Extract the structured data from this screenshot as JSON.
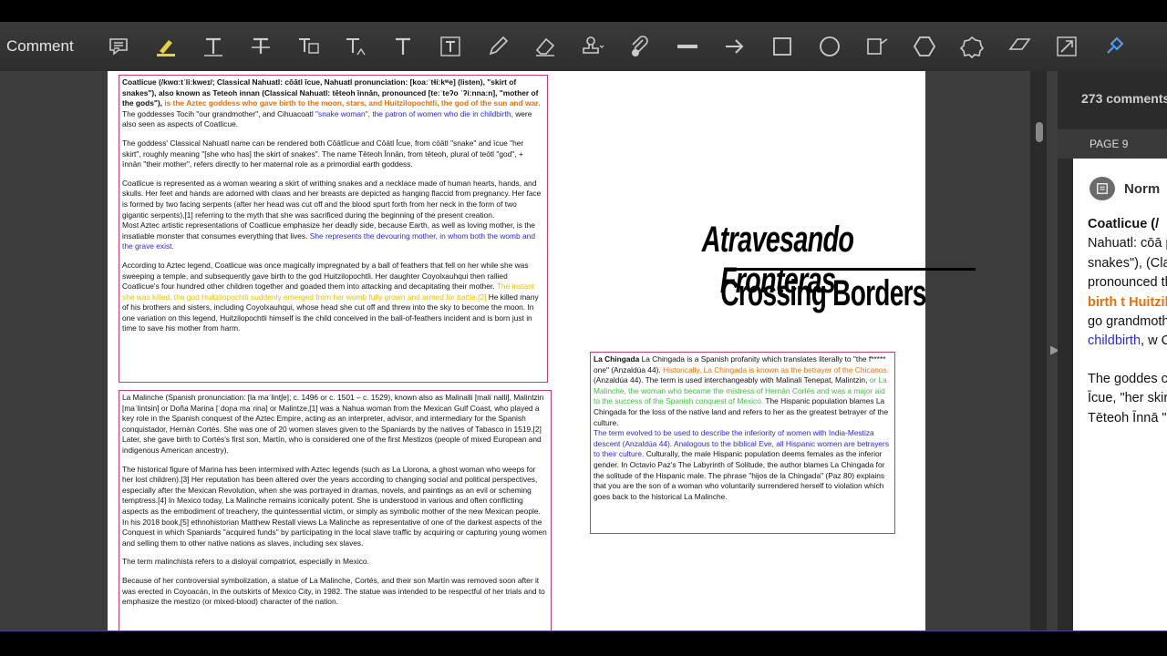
{
  "toolbar": {
    "label": "Comment",
    "tools": [
      "sticky-note-icon",
      "highlight-icon",
      "text-correction-icon",
      "strikethrough-icon",
      "replace-text-icon",
      "insert-text-icon",
      "add-text-icon",
      "text-box-icon",
      "pencil-icon",
      "eraser-icon",
      "stamp-icon",
      "attach-file-icon",
      "line-icon",
      "arrow-icon",
      "rectangle-icon",
      "oval-icon",
      "callout-icon",
      "polygon-icon",
      "cloud-icon",
      "polyline-icon",
      "connected-lines-icon",
      "pin-icon"
    ]
  },
  "document": {
    "coatlicue": {
      "p1_a": "Coatlicue (/kwɑːtˈliːkweɪ/; Classical Nahuatl: cōātl īcue, Nahuatl pronunciation: [koaːˈtɬíːkʷe] (listen), \"skirt of snakes\"), also known as Teteoh innan (Classical Nahuatl: tēteoh īnnān, pronounced [teːˈteʔo ˈʔiːnnaːn], \"mother of the gods\"), ",
      "p1_orange": "is the Aztec goddess who gave birth to the moon, stars, and Huitzilopochtli, the god of the sun and war",
      "p1_b": ". The goddesses Tocih \"our grandmother\", and Cihuacoatl ",
      "p1_blue": "\"snake woman\", the patron of women who die in childbirth",
      "p1_c": ", were also seen as aspects of Coatlicue.",
      "p2": "The goddess' Classical Nahuatl name can be rendered both Cōātlīcue and Cōātl Īcue, from cōātl \"snake\" and īcue \"her skirt\", roughly meaning \"[she who has] the skirt of snakes\". The name Tēteoh Īnnān, from tēteoh, plural of teōtl \"god\", + īnnān \"their mother\", refers directly to her maternal role as a primordial earth goddess.",
      "p3": "Coatlicue is represented as a woman wearing a skirt of writhing snakes and a necklace made of human hearts, hands, and skulls. Her feet and hands are adorned with claws and her breasts are depicted as hanging flaccid from pregnancy. Her face is formed by two facing serpents (after her head was cut off and the blood spurt forth from her neck in the form of two gigantic serpents),[1] referring to the myth that she was sacrificed during the beginning of the present creation.",
      "p4_a": "Most Aztec artistic representations of Coatlicue emphasize her deadly side, because Earth, as well as loving mother, is the insatiable monster that consumes everything that lives. ",
      "p4_blue": "She represents the devouring mother, in whom both the womb and the grave exist.",
      "p5_a": "According to Aztec legend, Coatlicue was once magically impregnated by a ball of feathers that fell on her while she was sweeping a temple, and subsequently gave birth to the god Huitzilopochtli. Her daughter Coyolxauhqui then rallied Coatlicue's four hundred other children together and goaded them into attacking and decapitating their mother. ",
      "p5_yellow": "The instant she was killed, the god Huitzilopochtli suddenly emerged from her womb fully grown and armed for battle.[2]",
      "p5_b": " He killed many of his brothers and sisters, including Coyolxauhqui, whose head she cut off and threw into the sky to become the moon. In one variation on this legend, Huitzilopochtli himself is the child conceived in the ball-of-feathers incident and is born just in time to save his mother from harm."
    },
    "malinche": {
      "p1": "La Malinche (Spanish pronunciation: [la maˈlintʃe]; c. 1496 or c. 1501 – c. 1529), known also as Malinalli [maliˈnalli], Malintzin [maˈlintsin] or Doña Marina [ˈdoɲa maˈɾina] or Malintze,[1] was a Nahua woman from the Mexican Gulf Coast, who played a key role in the Spanish conquest of the Aztec Empire, acting as an interpreter, advisor, and intermediary for the Spanish conquistador, Hernán Cortés. She was one of 20 women slaves given to the Spaniards by the natives of Tabasco in 1519.[2] Later, she gave birth to Cortés's first son, Martín, who is considered one of the first Mestizos (people of mixed European and indigenous American ancestry).",
      "p2": "The historical figure of Marina has been intermixed with Aztec legends (such as La Llorona, a ghost woman who weeps for her lost children).[3] Her reputation has been altered over the years according to changing social and political perspectives, especially after the Mexican Revolution, when she was portrayed in dramas, novels, and paintings as an evil or scheming temptress.[4] In Mexico today, La Malinche remains iconically potent. She is understood in various and often conflicting aspects as the embodiment of treachery, the quintessential victim, or simply as symbolic mother of the new Mexican people. In his 2018 book,[5] ethnohistorian Matthew Restall views La Malinche as representative of one of the darkest aspects of the Conquest in which Spaniards \"acquired funds\" by participating in the local slave traffic by acquiring or capturing young women and selling them to other native nations as slaves, including sex slaves.",
      "p3": "The term malinchista refers to a disloyal compatriot, especially in Mexico.",
      "p4": "Because of her controversial symbolization, a statue of La Malinche, Cortés, and their son Martín was removed soon after it was erected in Coyoacán, in the outskirts of Mexico City, in 1982. The statue was intended to be respectful of her trials and to emphasize the mestizo (or mixed-blood) character of the nation."
    },
    "title_line1": "Atravesando Fronteras",
    "title_line2": "Crossing Borders",
    "chingada": {
      "a": "La Chingada is a Spanish profanity which translates literally to \"the f*****",
      "b": "one\" (Anzaldúa 44). ",
      "orange": "Historically, La Chingada is known as the betrayer of the Chicanos.",
      "c": "(Anzaldúa 44). The term is used interchangeably with Malinali Tenepat, Malintzin, ",
      "green": "or La Malinche, the woman who became the mistress of Hernán Cortés and was a major aid to the success of the Spanish conquest of Mexico.",
      "d": " The Hispanic population blames La Chingada for the loss of the native land and refers to her as the greatest betrayer of the culture.",
      "blue": "The term evolved to be used to describe the inferiority of women with India-Mestiza descent (Anzaldúa 44). Analogous to the biblical Eve, all Hispanic women are betrayers to their culture.",
      "e": " Culturally, the male Hispanic population deems females as the inferior gender. In Octavio Paz's The Labyrinth of Solitude, the author blames La Chingada for the solitude of the Hispanic male. The phrase \"hijos de la Chingada\" (Paz 80) explains that you are the son of a woman who voluntarily surrendered herself to violation which goes back to the historical La Malinche."
    }
  },
  "panel": {
    "count": "273 comments",
    "page_label": "PAGE 9",
    "author": "Norm",
    "comment_bold": "Coatlicue (/",
    "comment_a": "Nahuatl: cōā pronunciation of snakes\"), (Classical N pronounced the gods\"), ",
    "comment_orange": "i gave birth t Huitzilopoc war",
    "comment_b": ". The go grandmothe",
    "comment_blue": "woman\", the childbirth",
    "comment_c": ", w Coatlicue.",
    "comment2": "The goddes can be rend Cōātl Īcue, \"her skirt\", r has] the skir Tēteoh Īnnā \"god\", + īnn"
  }
}
